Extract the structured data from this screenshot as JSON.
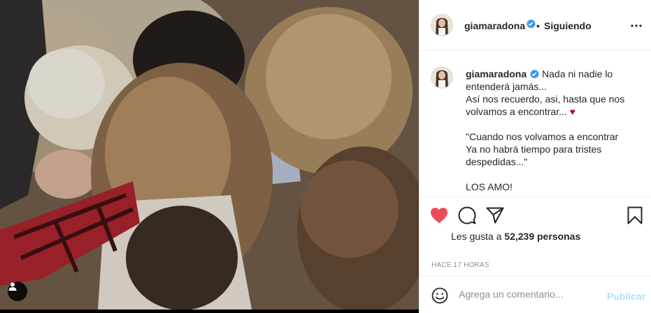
{
  "header": {
    "username": "giamaradona",
    "separator": "•",
    "follow_label": "Siguiendo",
    "more_icon": "more-horizontal-icon"
  },
  "caption": {
    "username": "giamaradona",
    "lines": [
      "Nada ni nadie lo entenderá jamás...",
      "Así nos recuerdo, asi, hasta que nos volvamos a encontrar...",
      "\"Cuando nos volvamos a encontrar",
      "Ya no habrá tiempo para tristes despedidas...\"",
      "LOS AMO!"
    ],
    "heart_emoji": "♥"
  },
  "actions": {
    "like_icon": "heart-filled-icon",
    "comment_icon": "comment-icon",
    "share_icon": "paper-plane-icon",
    "save_icon": "bookmark-icon",
    "likes_prefix": "Les gusta a",
    "likes_count": "52,239",
    "likes_suffix": "personas",
    "time_label": "HACE 17 HORAS"
  },
  "comment": {
    "placeholder": "Agrega un comentario...",
    "publish_label": "Publicar",
    "emoji_icon": "smiley-icon"
  },
  "colors": {
    "like_red": "#ed4956",
    "verified_blue": "#3897f0",
    "publish_blue": "#b2dffc",
    "muted_gray": "#8e8e8e"
  },
  "media": {
    "user_tag_icon": "user-tag-icon"
  }
}
